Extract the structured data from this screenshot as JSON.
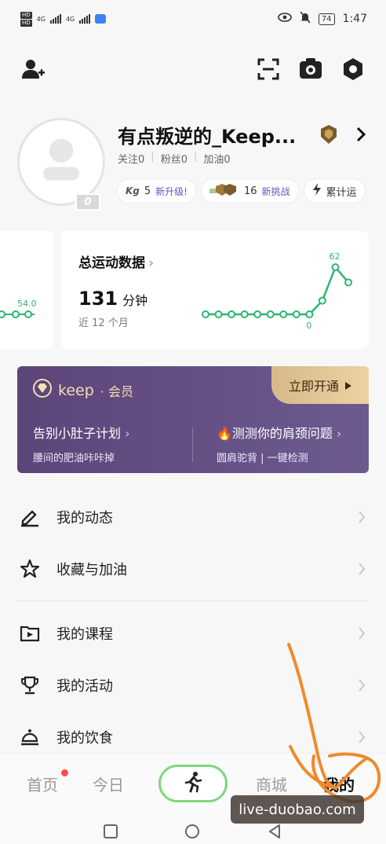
{
  "status_bar": {
    "hd1": "HD",
    "hd2": "HD",
    "signal1": "4G",
    "signal2": "4G",
    "battery": "74",
    "time": "1:47"
  },
  "topbar": {
    "add_friend_icon": "add-user-icon",
    "scan_icon": "scan-icon",
    "camera_icon": "camera-icon",
    "settings_icon": "gear-icon"
  },
  "profile": {
    "nickname": "有点叛逆的_Keep...",
    "level_badge": "0",
    "stats": [
      {
        "label": "关注",
        "value": "0"
      },
      {
        "label": "粉丝",
        "value": "0"
      },
      {
        "label": "加油",
        "value": "0"
      }
    ],
    "chips": {
      "kg_logo": "Kg",
      "kg_level": "5",
      "kg_tag": "新升级!",
      "medal_count": "16",
      "medal_tag": "新挑战",
      "total_label": "累计运"
    }
  },
  "stats_card": {
    "left_value": "54.0",
    "title": "总运动数据",
    "value": "131",
    "unit": "分钟",
    "subtitle": "近 12 个月",
    "chart_peak_label": "62",
    "chart_zero_label": "0"
  },
  "chart_data": {
    "type": "line",
    "x": [
      1,
      2,
      3,
      4,
      5,
      6,
      7,
      8,
      9,
      10,
      11,
      12
    ],
    "values": [
      0,
      0,
      0,
      0,
      0,
      0,
      0,
      0,
      0,
      18,
      62,
      42
    ],
    "title": "总运动数据",
    "xlabel": "",
    "ylabel": "",
    "grid": false
  },
  "vip": {
    "brand": "keep",
    "brand_suffix": "· 会员",
    "cta": "立即开通",
    "items": [
      {
        "title": "告别小肚子计划",
        "subtitle": "腰间的肥油咔咔掉"
      },
      {
        "title": "测测你的肩颈问题",
        "subtitle": "圆肩驼背 | 一键检测"
      }
    ]
  },
  "menu": [
    {
      "label": "我的动态",
      "icon": "pencil-icon"
    },
    {
      "label": "收藏与加油",
      "icon": "star-icon"
    },
    {
      "label": "我的课程",
      "icon": "play-icon"
    },
    {
      "label": "我的活动",
      "icon": "trophy-icon"
    },
    {
      "label": "我的饮食",
      "icon": "food-cloche-icon"
    }
  ],
  "tabbar": {
    "tabs": [
      {
        "label": "首页"
      },
      {
        "label": "今日"
      },
      {
        "label": "商城"
      },
      {
        "label": "我的"
      }
    ],
    "run_icon": "running-icon"
  },
  "watermark": "live-duobao.com",
  "colors": {
    "accent_green": "#2bb673",
    "vip_purple": "#5c4579",
    "vip_gold": "#e2c594",
    "annotation_orange": "#f08a2c"
  }
}
